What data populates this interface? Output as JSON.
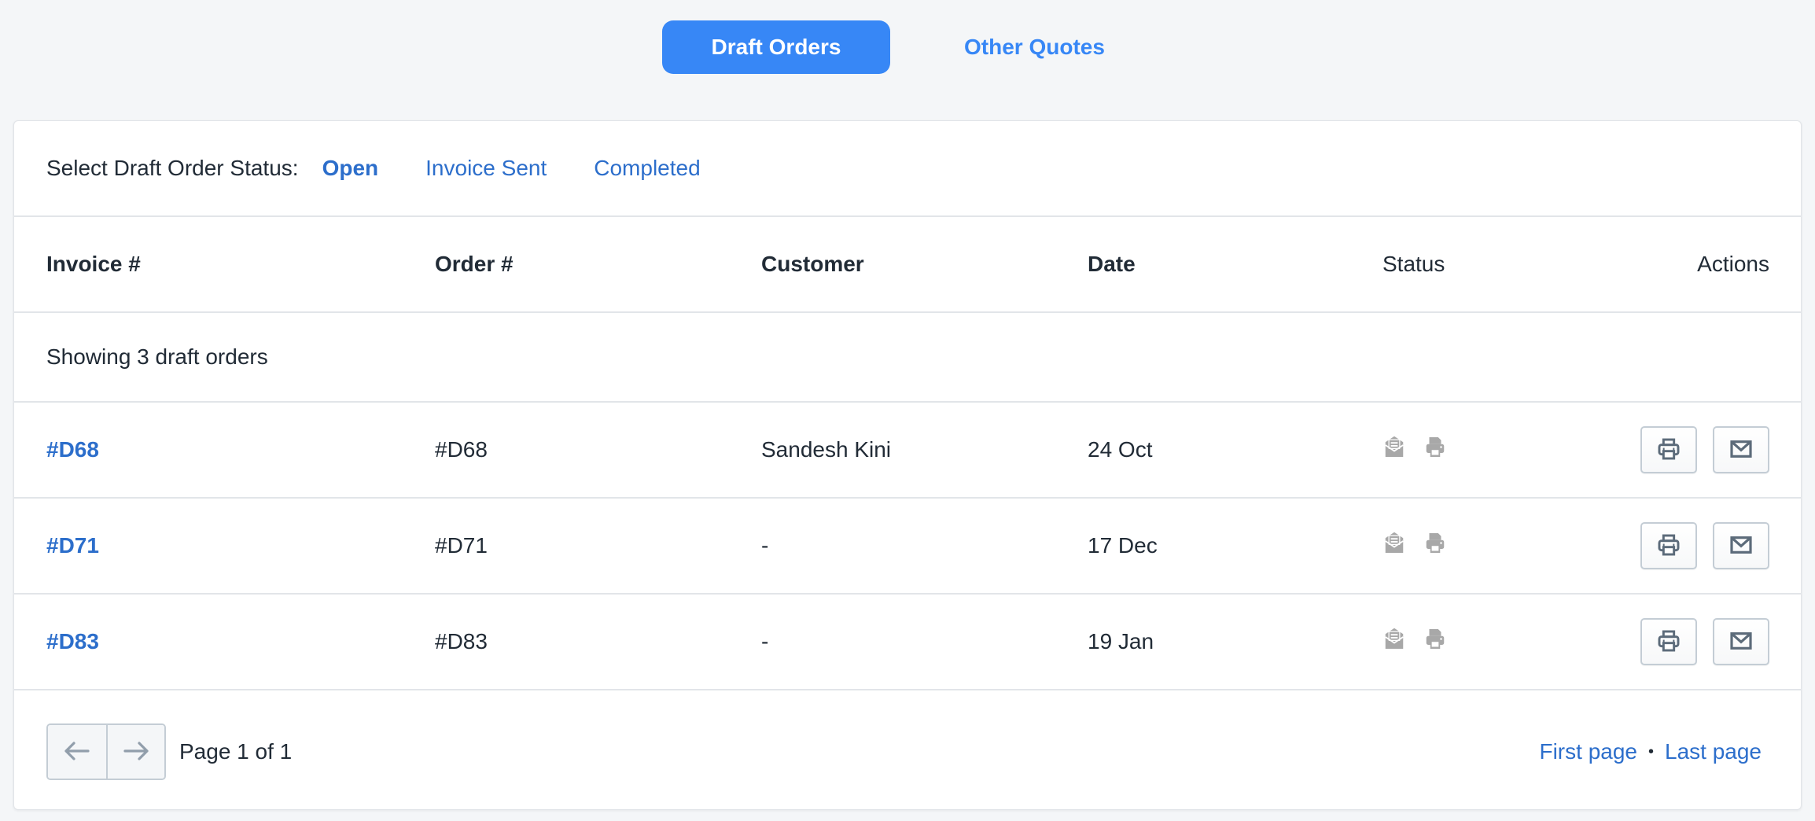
{
  "tabs": [
    {
      "label": "Draft Orders",
      "active": true
    },
    {
      "label": "Other Quotes",
      "active": false
    }
  ],
  "filter": {
    "label": "Select Draft Order Status:",
    "options": [
      {
        "label": "Open",
        "active": true
      },
      {
        "label": "Invoice Sent",
        "active": false
      },
      {
        "label": "Completed",
        "active": false
      }
    ]
  },
  "table": {
    "columns": [
      "Invoice #",
      "Order #",
      "Customer",
      "Date",
      "Status",
      "Actions"
    ],
    "summary": "Showing 3 draft orders",
    "rows": [
      {
        "invoice": "#D68",
        "order": "#D68",
        "customer": "Sandesh Kini",
        "date": "24 Oct",
        "status_icons": [
          "envelope-open-icon",
          "printer-icon"
        ],
        "actions": [
          "print",
          "email"
        ]
      },
      {
        "invoice": "#D71",
        "order": "#D71",
        "customer": "-",
        "date": "17 Dec",
        "status_icons": [
          "envelope-open-icon",
          "printer-icon"
        ],
        "actions": [
          "print",
          "email"
        ]
      },
      {
        "invoice": "#D83",
        "order": "#D83",
        "customer": "-",
        "date": "19 Jan",
        "status_icons": [
          "envelope-open-icon",
          "printer-icon"
        ],
        "actions": [
          "print",
          "email"
        ]
      }
    ]
  },
  "pagination": {
    "page_info": "Page 1 of 1",
    "first_label": "First page",
    "separator": "•",
    "last_label": "Last page"
  },
  "colors": {
    "accent": "#3787f6",
    "link": "#2c6ecb",
    "status_icon": "#a8a8a8",
    "action_icon": "#5c6b7a"
  }
}
